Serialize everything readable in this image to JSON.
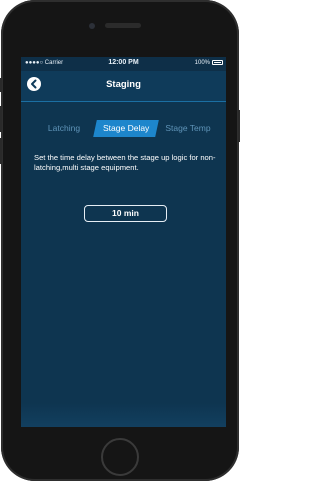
{
  "status_bar": {
    "carrier": "●●●●○ Carrier",
    "time": "12:00 PM",
    "battery": "100%"
  },
  "nav": {
    "title": "Staging",
    "back_icon": "back-arrow-icon"
  },
  "tabs": [
    {
      "label": "Latching",
      "active": false
    },
    {
      "label": "Stage Delay",
      "active": true
    },
    {
      "label": "Stage Temp",
      "active": false
    }
  ],
  "description": "Set the time delay between the stage up logic for non-latching,multi stage equipment.",
  "delay_value": "10 min",
  "colors": {
    "background": "#0e3550",
    "accent": "#1d86cc",
    "navbar": "#0f3b5a"
  }
}
